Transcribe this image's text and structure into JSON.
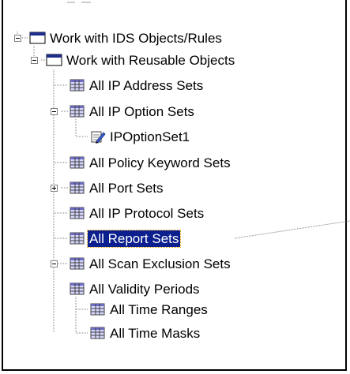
{
  "tree": {
    "root": {
      "label": "Work with IDS Objects/Rules",
      "expanded": true
    },
    "reusable": {
      "label": "Work with Reusable Objects",
      "expanded": true
    },
    "items": [
      {
        "label": "All IP Address Sets",
        "icon": "table-icon"
      },
      {
        "label": "All IP Option Sets",
        "icon": "table-icon",
        "expanded": true
      },
      {
        "label": "IPOptionSet1",
        "icon": "edit-object-icon"
      },
      {
        "label": "All Policy Keyword Sets",
        "icon": "table-icon"
      },
      {
        "label": "All Port Sets",
        "icon": "table-icon",
        "expanded": false
      },
      {
        "label": "All IP Protocol Sets",
        "icon": "table-icon"
      },
      {
        "label": "All Report Sets",
        "icon": "table-icon",
        "selected": true
      },
      {
        "label": "All Scan Exclusion Sets",
        "icon": "table-icon"
      },
      {
        "label": "All Validity Periods",
        "icon": "table-icon",
        "expanded": true
      },
      {
        "label": "All Time Ranges",
        "icon": "table-icon"
      },
      {
        "label": "All Time Masks",
        "icon": "table-icon"
      }
    ]
  },
  "colors": {
    "selection_bg": "#0b1f8f",
    "selection_text": "#ffffff",
    "tree_line": "#808080",
    "folder_title": "#1c2d8c"
  }
}
